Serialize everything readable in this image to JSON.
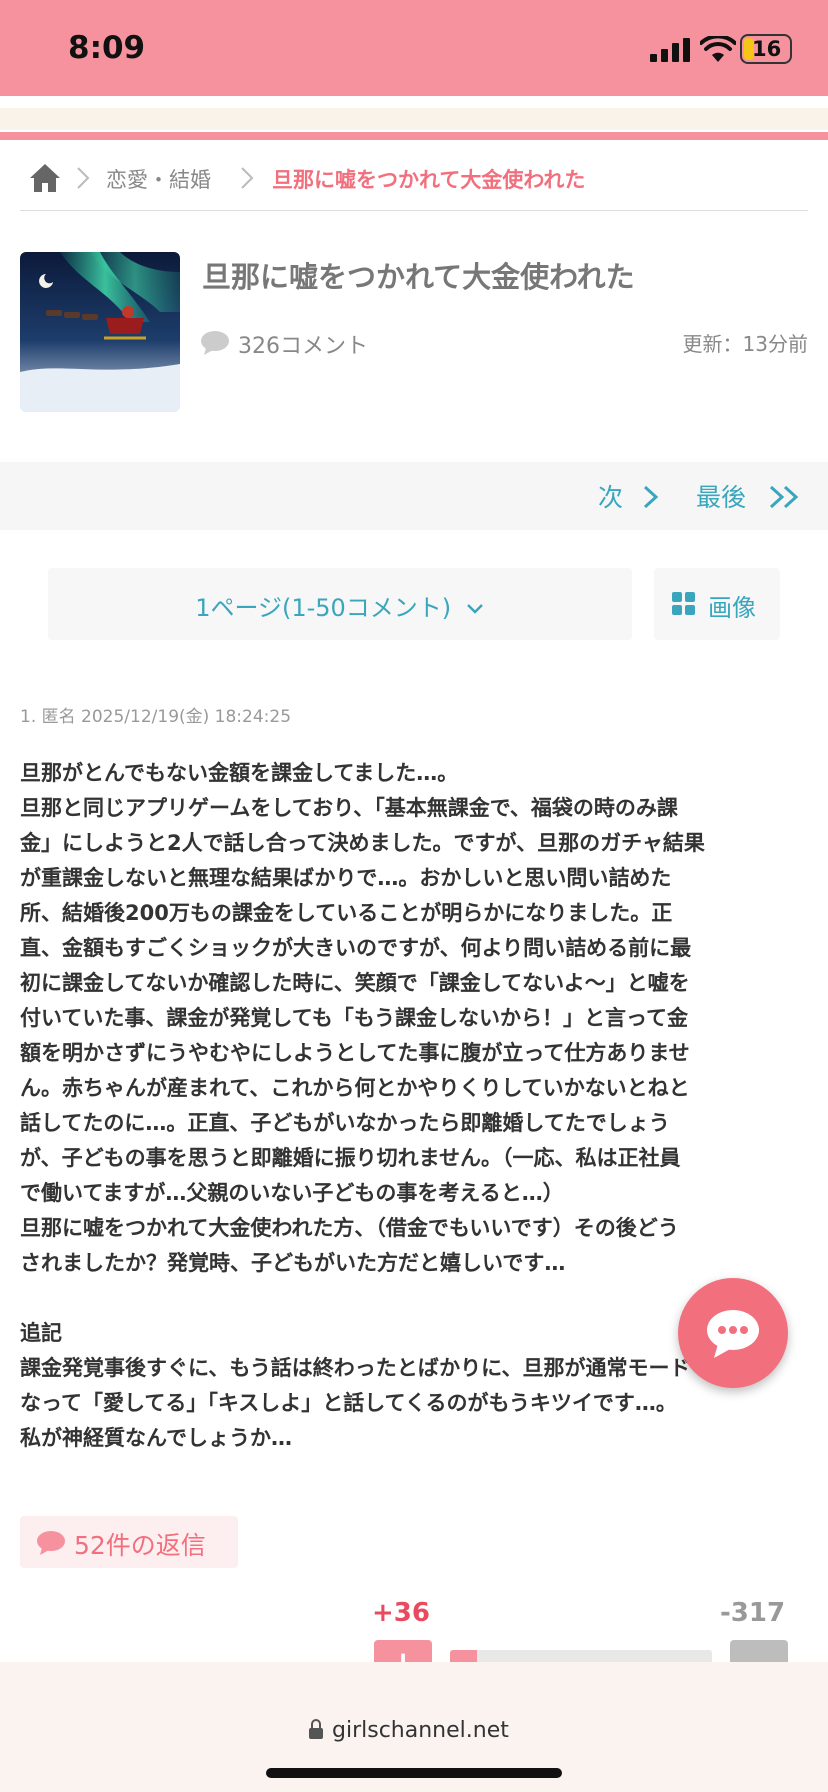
{
  "status_bar": {
    "time": "8:09",
    "battery": "16"
  },
  "breadcrumb": {
    "home_icon": "home-icon",
    "category": "恋愛・結婚",
    "current": "旦那に嘘をつかれて大金使われた"
  },
  "topic": {
    "title": "旦那に嘘をつかれて大金使われた",
    "comment_count": "326コメント",
    "updated": "更新：13分前"
  },
  "pager": {
    "next_label": "次",
    "last_label": "最後",
    "page_selector": "1ページ(1-50コメント)",
    "image_button": "画像"
  },
  "comment": {
    "meta": "1. 匿名 2025/12/19(金) 18:24:25",
    "body": "旦那がとんでもない金額を課金してました…。\n旦那と同じアプリゲームをしており、「基本無課金で、福袋の時のみ課\n金」にしようと2人で話し合って決めました。ですが、旦那のガチャ結果\nが重課金しないと無理な結果ばかりで…。おかしいと思い問い詰めた\n所、結婚後200万もの課金をしていることが明らかになりました。正\n直、金額もすごくショックが大きいのですが、何より問い詰める前に最\n初に課金してないか確認した時に、笑顔で「課金してないよ〜」と嘘を\n付いていた事、課金が発覚しても「もう課金しないから！」と言って金\n額を明かさずにうやむやにしようとしてた事に腹が立って仕方ありませ\nん。赤ちゃんが産まれて、これから何とかやりくりしていかないとねと\n話してたのに…。正直、子どもがいなかったら即離婚してたでしょう\nが、子どもの事を思うと即離婚に振り切れません。（一応、私は正社員\nで働いてますが…父親のいない子どもの事を考えると…）\n旦那に嘘をつかれて大金使われた方、（借金でもいいです）その後どう\nされましたか？発覚時、子どもがいた方だと嬉しいです…\n\n追記\n課金発覚事後すぐに、もう話は終わったとばかりに、旦那が通常モード\nなって「愛してる」「キスしよ」と話してくるのがもうキツイです…。\n私が神経質なんでしょうか…",
    "replies": "52件の返信",
    "plus": "+36",
    "minus": "-317",
    "plus_fraction": 0.102,
    "plus_symbol": "+",
    "minus_symbol": "−"
  },
  "browser": {
    "url": "girlschannel.net"
  },
  "colors": {
    "accent_pink": "#f6929e",
    "link_teal": "#3aa6bd",
    "title_red": "#f26f7e"
  }
}
